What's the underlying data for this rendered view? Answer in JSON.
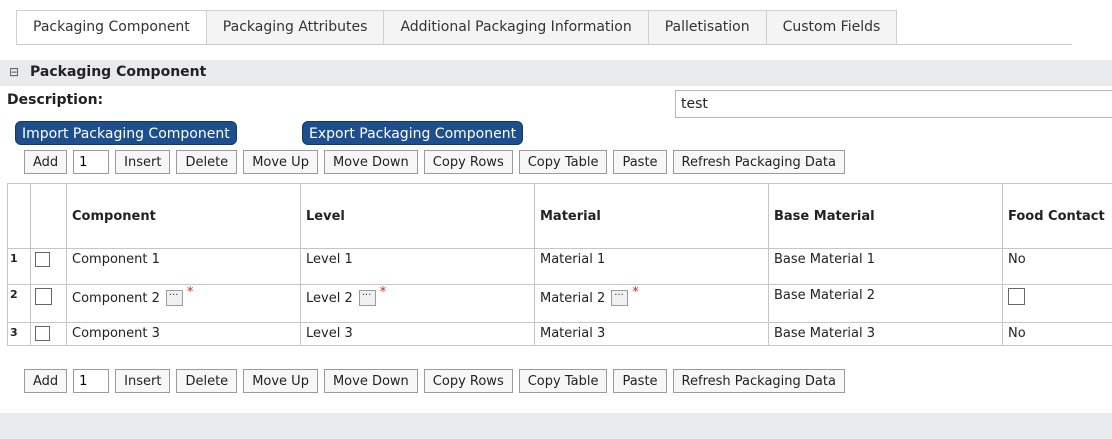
{
  "tabs": [
    "Packaging Component",
    "Packaging Attributes",
    "Additional Packaging Information",
    "Palletisation",
    "Custom Fields"
  ],
  "section": {
    "toggle": "⊟",
    "title": "Packaging Component"
  },
  "description": {
    "label": "Description:",
    "value": "test"
  },
  "actions": {
    "import_label": "Import Packaging Component",
    "export_label": "Export Packaging Component"
  },
  "toolbar": {
    "add": "Add",
    "count": "1",
    "insert": "Insert",
    "delete": "Delete",
    "move_up": "Move Up",
    "move_down": "Move Down",
    "copy_rows": "Copy Rows",
    "copy_table": "Copy Table",
    "paste": "Paste",
    "refresh": "Refresh Packaging Data"
  },
  "table": {
    "headers": [
      "Component",
      "Level",
      "Material",
      "Base Material",
      "Food Contact"
    ],
    "rows": [
      {
        "index": "1",
        "component": "Component 1",
        "level": "Level 1",
        "material": "Material 1",
        "base_material": "Base Material 1",
        "food_contact": "No"
      },
      {
        "index": "2",
        "component": "Component 2",
        "level": "Level 2",
        "material": "Material 2",
        "base_material": "Base Material 2",
        "food_contact": ""
      },
      {
        "index": "3",
        "component": "Component 3",
        "level": "Level 3",
        "material": "Material 3",
        "base_material": "Base Material 3",
        "food_contact": "No"
      }
    ],
    "required_marker": "*"
  },
  "colors": {
    "primary_button": "#1e4f8c",
    "section_bg": "#e9eaec",
    "required": "#e02020"
  }
}
